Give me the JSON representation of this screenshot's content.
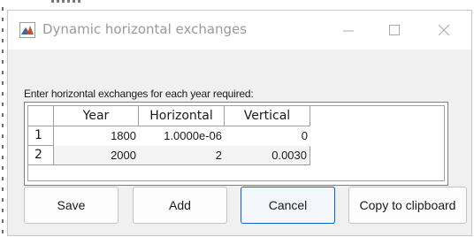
{
  "window": {
    "title": "Dynamic horizontal exchanges",
    "controls": [
      "minimize-icon",
      "maximize-icon",
      "close-icon"
    ]
  },
  "prompt": "Enter horizontal exchanges for each year required:",
  "table": {
    "columns": [
      "Year",
      "Horizontal",
      "Vertical"
    ],
    "rows": [
      {
        "index": "1",
        "year": "1800",
        "horizontal": "1.0000e-06",
        "vertical": "0"
      },
      {
        "index": "2",
        "year": "2000",
        "horizontal": "2",
        "vertical": "0.0030"
      }
    ]
  },
  "buttons": {
    "save": "Save",
    "add": "Add",
    "cancel": "Cancel",
    "copy": "Copy to clipboard"
  },
  "colors": {
    "accent": "#0a64c8",
    "window_bg": "#f0f0f0",
    "titlebar_bg": "#ffffff"
  }
}
